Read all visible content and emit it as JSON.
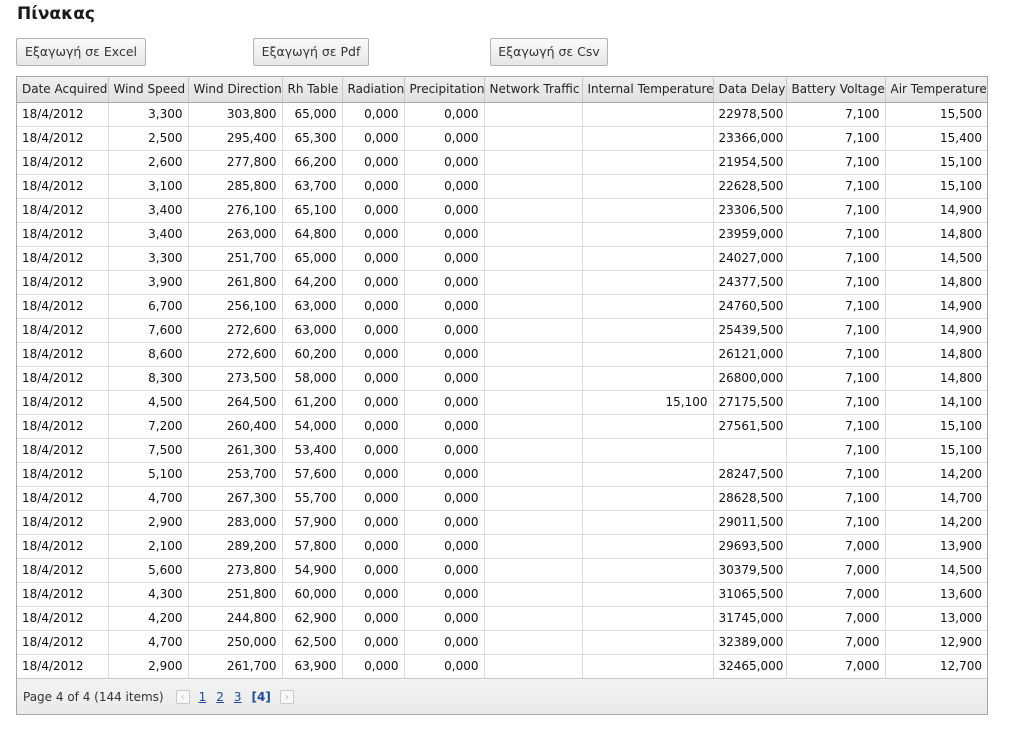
{
  "page_title": "Πίνακας",
  "exports": {
    "excel": "Εξαγωγή σε Excel",
    "pdf": "Εξαγωγή σε Pdf",
    "csv": "Εξαγωγή σε Csv"
  },
  "table": {
    "columns": [
      "Date Acquired",
      "Wind Speed",
      "Wind Direction",
      "Rh Table",
      "Radiation",
      "Precipitation",
      "Network Traffic",
      "Internal Temperature",
      "Data Delay",
      "Battery Voltage",
      "Air Temperature"
    ],
    "rows": [
      [
        "18/4/2012",
        "3,300",
        "303,800",
        "65,000",
        "0,000",
        "0,000",
        "",
        "",
        "22978,500",
        "7,100",
        "15,500"
      ],
      [
        "18/4/2012",
        "2,500",
        "295,400",
        "65,300",
        "0,000",
        "0,000",
        "",
        "",
        "23366,000",
        "7,100",
        "15,400"
      ],
      [
        "18/4/2012",
        "2,600",
        "277,800",
        "66,200",
        "0,000",
        "0,000",
        "",
        "",
        "21954,500",
        "7,100",
        "15,100"
      ],
      [
        "18/4/2012",
        "3,100",
        "285,800",
        "63,700",
        "0,000",
        "0,000",
        "",
        "",
        "22628,500",
        "7,100",
        "15,100"
      ],
      [
        "18/4/2012",
        "3,400",
        "276,100",
        "65,100",
        "0,000",
        "0,000",
        "",
        "",
        "23306,500",
        "7,100",
        "14,900"
      ],
      [
        "18/4/2012",
        "3,400",
        "263,000",
        "64,800",
        "0,000",
        "0,000",
        "",
        "",
        "23959,000",
        "7,100",
        "14,800"
      ],
      [
        "18/4/2012",
        "3,300",
        "251,700",
        "65,000",
        "0,000",
        "0,000",
        "",
        "",
        "24027,000",
        "7,100",
        "14,500"
      ],
      [
        "18/4/2012",
        "3,900",
        "261,800",
        "64,200",
        "0,000",
        "0,000",
        "",
        "",
        "24377,500",
        "7,100",
        "14,800"
      ],
      [
        "18/4/2012",
        "6,700",
        "256,100",
        "63,000",
        "0,000",
        "0,000",
        "",
        "",
        "24760,500",
        "7,100",
        "14,900"
      ],
      [
        "18/4/2012",
        "7,600",
        "272,600",
        "63,000",
        "0,000",
        "0,000",
        "",
        "",
        "25439,500",
        "7,100",
        "14,900"
      ],
      [
        "18/4/2012",
        "8,600",
        "272,600",
        "60,200",
        "0,000",
        "0,000",
        "",
        "",
        "26121,000",
        "7,100",
        "14,800"
      ],
      [
        "18/4/2012",
        "8,300",
        "273,500",
        "58,000",
        "0,000",
        "0,000",
        "",
        "",
        "26800,000",
        "7,100",
        "14,800"
      ],
      [
        "18/4/2012",
        "4,500",
        "264,500",
        "61,200",
        "0,000",
        "0,000",
        "",
        "15,100",
        "27175,500",
        "7,100",
        "14,100"
      ],
      [
        "18/4/2012",
        "7,200",
        "260,400",
        "54,000",
        "0,000",
        "0,000",
        "",
        "",
        "27561,500",
        "7,100",
        "15,100"
      ],
      [
        "18/4/2012",
        "7,500",
        "261,300",
        "53,400",
        "0,000",
        "0,000",
        "",
        "",
        "",
        "7,100",
        "15,100"
      ],
      [
        "18/4/2012",
        "5,100",
        "253,700",
        "57,600",
        "0,000",
        "0,000",
        "",
        "",
        "28247,500",
        "7,100",
        "14,200"
      ],
      [
        "18/4/2012",
        "4,700",
        "267,300",
        "55,700",
        "0,000",
        "0,000",
        "",
        "",
        "28628,500",
        "7,100",
        "14,700"
      ],
      [
        "18/4/2012",
        "2,900",
        "283,000",
        "57,900",
        "0,000",
        "0,000",
        "",
        "",
        "29011,500",
        "7,100",
        "14,200"
      ],
      [
        "18/4/2012",
        "2,100",
        "289,200",
        "57,800",
        "0,000",
        "0,000",
        "",
        "",
        "29693,500",
        "7,000",
        "13,900"
      ],
      [
        "18/4/2012",
        "5,600",
        "273,800",
        "54,900",
        "0,000",
        "0,000",
        "",
        "",
        "30379,500",
        "7,000",
        "14,500"
      ],
      [
        "18/4/2012",
        "4,300",
        "251,800",
        "60,000",
        "0,000",
        "0,000",
        "",
        "",
        "31065,500",
        "7,000",
        "13,600"
      ],
      [
        "18/4/2012",
        "4,200",
        "244,800",
        "62,900",
        "0,000",
        "0,000",
        "",
        "",
        "31745,000",
        "7,000",
        "13,000"
      ],
      [
        "18/4/2012",
        "4,700",
        "250,000",
        "62,500",
        "0,000",
        "0,000",
        "",
        "",
        "32389,000",
        "7,000",
        "12,900"
      ],
      [
        "18/4/2012",
        "2,900",
        "261,700",
        "63,900",
        "0,000",
        "0,000",
        "",
        "",
        "32465,000",
        "7,000",
        "12,700"
      ]
    ]
  },
  "pager": {
    "info": "Page 4 of 4 (144 items)",
    "prev_icon": "chevron-left-icon",
    "next_icon": "chevron-right-icon",
    "pages": [
      "1",
      "2",
      "3"
    ],
    "current": "[4]"
  }
}
